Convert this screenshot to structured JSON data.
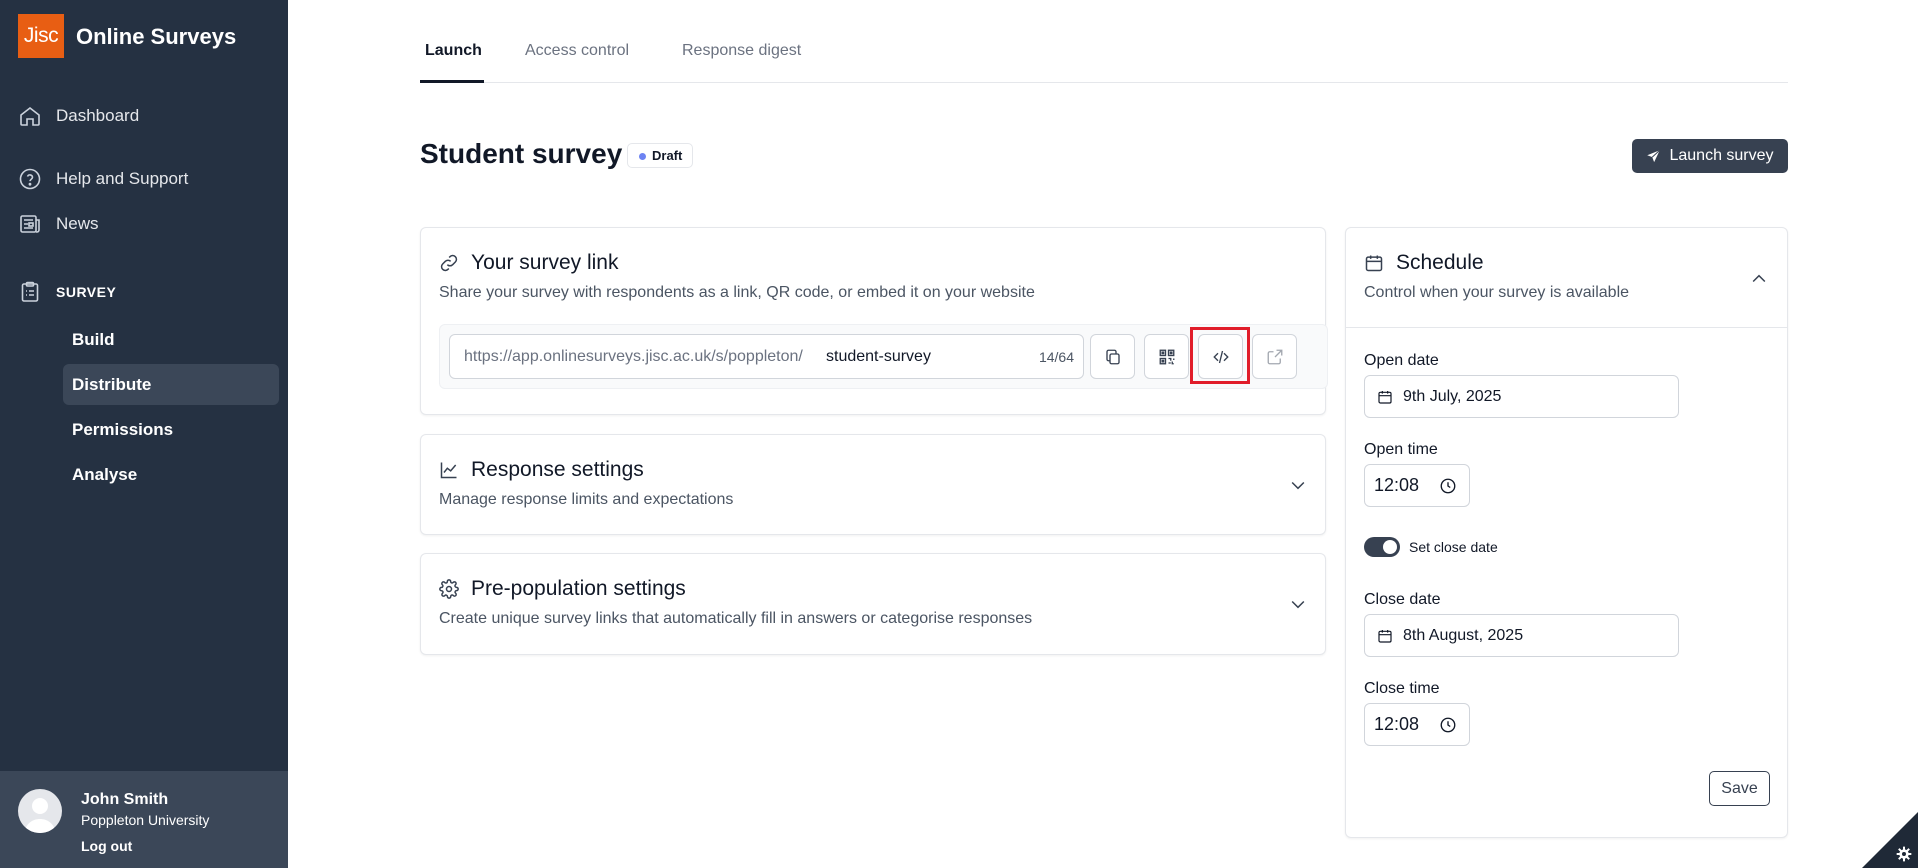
{
  "app": {
    "logo_text": "Jisc",
    "title": "Online Surveys",
    "brand_color": "#e85e13",
    "sidebar_color": "#253142"
  },
  "sidebar": {
    "dashboard": "Dashboard",
    "help": "Help and Support",
    "news": "News",
    "section": "SURVEY",
    "items": [
      {
        "label": "Build"
      },
      {
        "label": "Distribute",
        "active": true
      },
      {
        "label": "Permissions"
      },
      {
        "label": "Analyse"
      }
    ]
  },
  "user": {
    "name": "John Smith",
    "org": "Poppleton University",
    "logout": "Log out"
  },
  "tabs": [
    {
      "label": "Launch",
      "active": true
    },
    {
      "label": "Access control"
    },
    {
      "label": "Response digest"
    }
  ],
  "header": {
    "title": "Student survey",
    "status": "Draft",
    "launch_label": "Launch survey"
  },
  "survey_link": {
    "title": "Your survey link",
    "description": "Share your survey with respondents as a link, QR code, or embed it on your website",
    "url_prefix": "https://app.onlinesurveys.jisc.ac.uk/s/poppleton/",
    "slug": "student-survey",
    "char_count": "14/64",
    "actions": [
      "copy-icon",
      "qr-code-icon",
      "code-embed-icon",
      "external-link-icon"
    ]
  },
  "response_settings": {
    "title": "Response settings",
    "description": "Manage response limits and expectations"
  },
  "prepopulation": {
    "title": "Pre-population settings",
    "description": "Create unique survey links that automatically fill in answers or categorise responses"
  },
  "schedule": {
    "title": "Schedule",
    "description": "Control when your survey is available",
    "open_date_label": "Open date",
    "open_date": "9th July, 2025",
    "open_time_label": "Open time",
    "open_time": "12:08",
    "close_toggle_label": "Set close date",
    "close_toggle_on": true,
    "close_date_label": "Close date",
    "close_date": "8th August, 2025",
    "close_time_label": "Close time",
    "close_time": "12:08",
    "save_label": "Save"
  }
}
